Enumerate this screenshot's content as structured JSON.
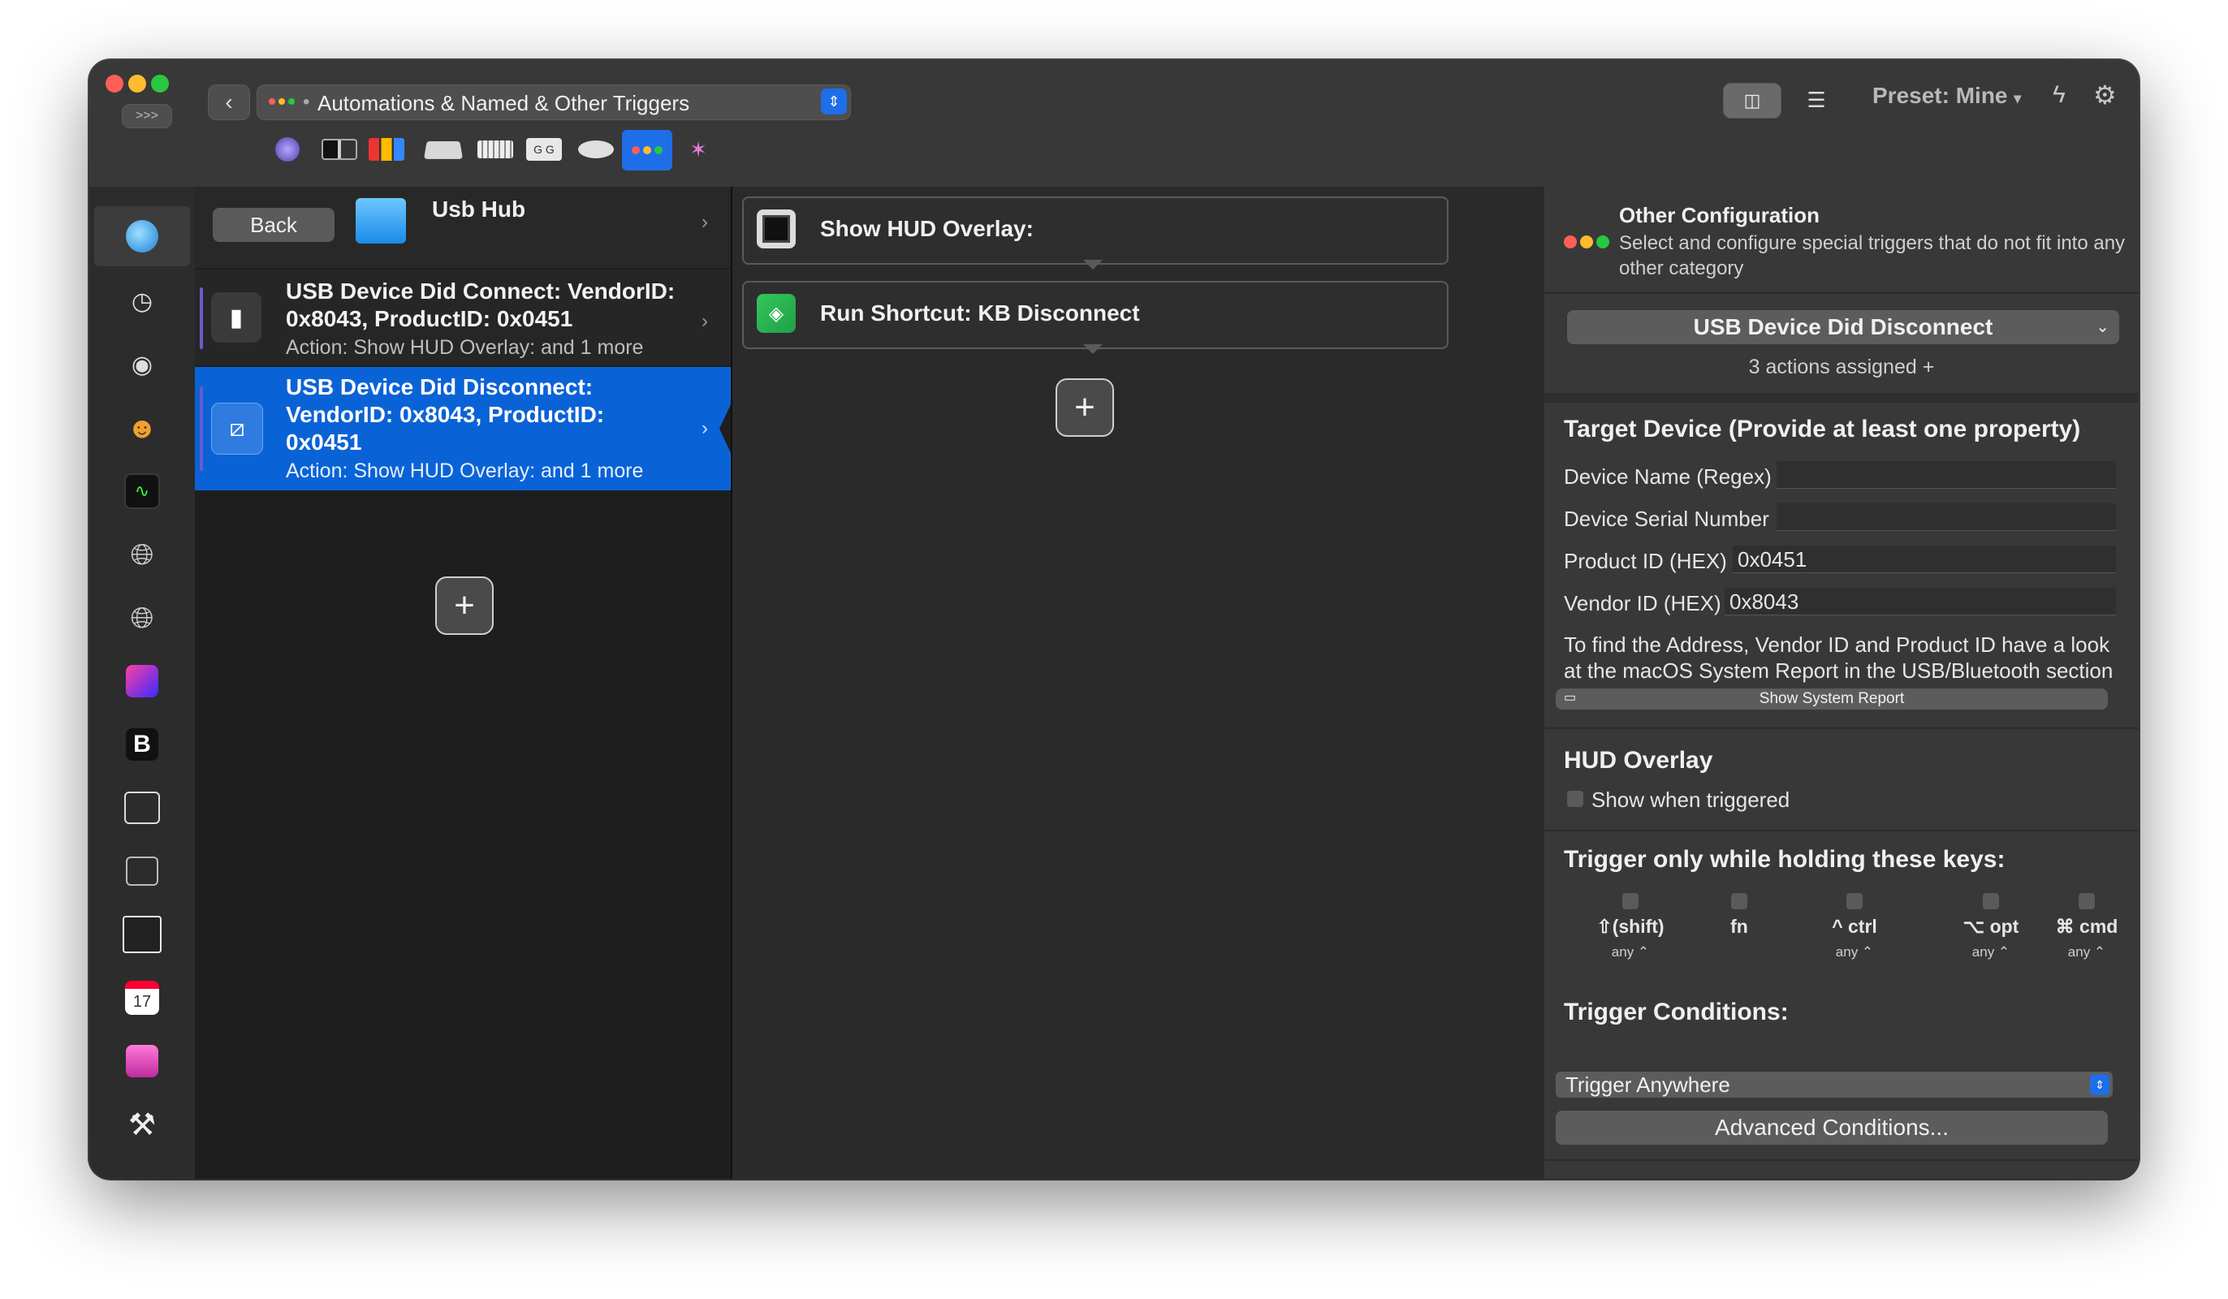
{
  "window": {
    "traffic_lights": [
      "#ff5f57",
      "#febc2e",
      "#28c840"
    ],
    "expand_label": ">>>",
    "breadcrumb": {
      "dots_prefix": "•",
      "title": "Automations & Named & Other Triggers"
    },
    "preset_label": "Preset: Mine",
    "preset_caret": "▾"
  },
  "toolbar_icons": [
    "siri-icon",
    "touchbar-icon",
    "stream-deck-icon",
    "trackpad-icon",
    "keyboard-icon",
    "key-sequences-icon",
    "mouse-icon",
    "other-triggers-icon",
    "automation-star-icon"
  ],
  "sidebar": {
    "items": [
      "globe-icon",
      "clock-icon",
      "record-icon",
      "brain-icon",
      "activity-icon",
      "safari-globe-icon",
      "chrome-globe-icon",
      "arc-icon",
      "bbedit-icon",
      "menubar-icon",
      "menubar-alt-icon",
      "web-window-icon",
      "calendar-icon",
      "pink-app-icon",
      "tools-icon",
      "partial-app-icon"
    ]
  },
  "col1": {
    "back_label": "Back",
    "group_title": "Usb Hub",
    "triggers": [
      {
        "title": "USB Device Did Connect: VendorID: 0x8043, ProductID: 0x0451",
        "subtitle": "Action: Show HUD Overlay:  and 1 more",
        "selected": false
      },
      {
        "title": "USB Device Did Disconnect: VendorID: 0x8043, ProductID: 0x0451",
        "subtitle": "Action: Show HUD Overlay:  and 1 more",
        "selected": true
      }
    ],
    "add_label": "+"
  },
  "col2": {
    "actions": [
      {
        "label": "Show HUD Overlay:"
      },
      {
        "label": "Run Shortcut: KB Disconnect"
      }
    ],
    "add_label": "+"
  },
  "config": {
    "title": "Other Configuration",
    "description": "Select and configure special triggers that do not  fit into any other category",
    "trigger_select": "USB Device Did Disconnect",
    "actions_assigned": "3 actions assigned +",
    "target_header": "Target Device (Provide at least one property)",
    "fields": [
      {
        "label": "Device Name (Regex)",
        "value": ""
      },
      {
        "label": "Device Serial Number",
        "value": ""
      },
      {
        "label": "Product ID (HEX)",
        "value": "0x0451"
      },
      {
        "label": "Vendor ID (HEX)",
        "value": "0x8043"
      }
    ],
    "help_text": "To find the Address, Vendor ID and Product ID have a look at the macOS System Report in the USB/Bluetooth section",
    "system_report_btn": "Show System Report",
    "hud_header": "HUD Overlay",
    "hud_checkbox": "Show when triggered",
    "keys_header": "Trigger only while holding these keys:",
    "modifiers": [
      {
        "label": "⇧(shift)",
        "state": "any ⌃"
      },
      {
        "label": "fn",
        "state": ""
      },
      {
        "label": "^ ctrl",
        "state": "any ⌃"
      },
      {
        "label": "⌥ opt",
        "state": "any ⌃"
      },
      {
        "label": "⌘ cmd",
        "state": "any ⌃"
      }
    ],
    "conditions_header": "Trigger Conditions:",
    "condition_select": "Trigger Anywhere",
    "advanced_btn": "Advanced Conditions..."
  },
  "colors": {
    "selection": "#0a63d6",
    "accent": "#1e6ee8"
  }
}
